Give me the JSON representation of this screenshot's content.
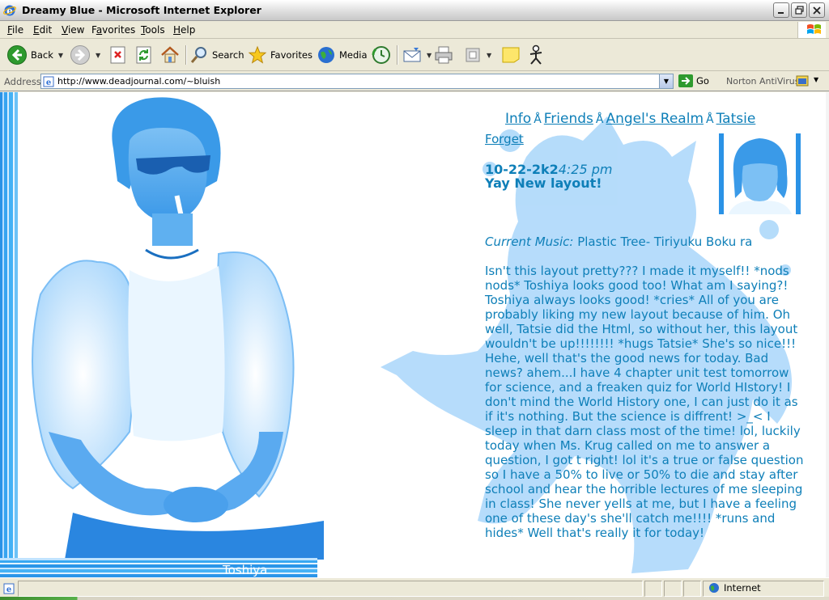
{
  "window": {
    "title": "Dreamy Blue - Microsoft Internet Explorer"
  },
  "menu": [
    "File",
    "Edit",
    "View",
    "Favorites",
    "Tools",
    "Help"
  ],
  "menu_access_keys": [
    "F",
    "E",
    "V",
    "a",
    "T",
    "H"
  ],
  "toolbar": {
    "back_label": "Back",
    "search_label": "Search",
    "favorites_label": "Favorites",
    "media_label": "Media"
  },
  "address": {
    "label": "Address",
    "url": "http://www.deadjournal.com/~bluish",
    "go_label": "Go",
    "norton_label": "Norton AntiVirus"
  },
  "page": {
    "nav": [
      "Info",
      "Friends",
      "Angel's Realm",
      "Tatsie"
    ],
    "nav_separator": "Å",
    "forget_link": "Forget",
    "date": "10-22-2k2",
    "time": "4:25 pm",
    "subject": "Yay New layout!",
    "music_label": "Current Music:",
    "music_value": "Plastic Tree- Tiriyuku Boku ra",
    "entry_text": "Isn't this layout pretty??? I made it myself!! *nods nods* Toshiya looks good too! What am I saying?! Toshiya always looks good! *cries* All of you are probably liking my new layout because of him. Oh well, Tatsie did the Html, so without her, this layout wouldn't be up!!!!!!!! *hugs Tatsie* She's so nice!!! Hehe, well that's the good news for today. Bad news? ahem...I have 4 chapter unit test tomorrow for science, and a freaken quiz for World HIstory! I don't mind the World History one, I can just do it as if it's nothing. But the science is diffrent! >_< I sleep in that darn class most of the time! lol, luckily today when Ms. Krug called on me to answer a question, I got t right! lol it's a true or false question so I have a 50% to live or 50% to die and stay after school and hear the horrible lectures of me sleeping in class! She never yells at me, but I have a feeling one of these day's she'll catch me!!!! *runs and hides* Well that's really it for today!",
    "photo_caption": "Toshiya"
  },
  "status": {
    "zone_label": "Internet"
  },
  "colors": {
    "accent": "#0e7fb8",
    "stripe": "#2a92e6",
    "chrome": "#ece9d8"
  }
}
